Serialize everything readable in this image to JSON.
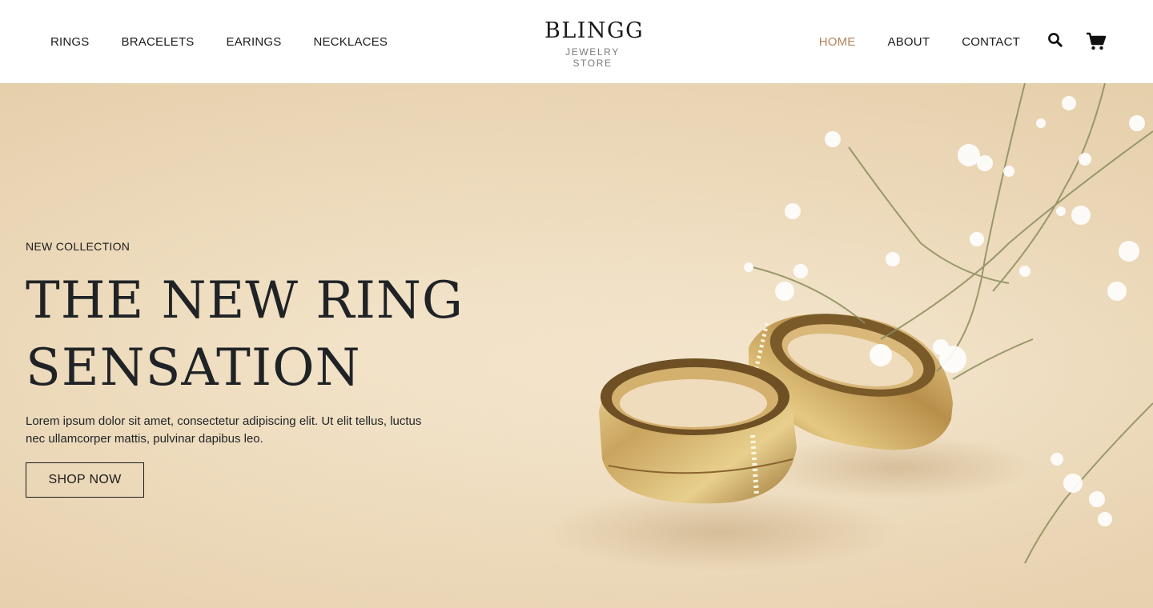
{
  "header": {
    "nav_left": [
      "RINGS",
      "BRACELETS",
      "EARINGS",
      "NECKLACES"
    ],
    "logo_title": "BLINGG",
    "logo_subtitle": "JEWELRY STORE",
    "nav_right": [
      "HOME",
      "ABOUT",
      "CONTACT"
    ],
    "active_item": "HOME",
    "icons": [
      "search-icon",
      "cart-icon"
    ]
  },
  "hero": {
    "eyebrow": "NEW COLLECTION",
    "headline_line1": "THE NEW RING",
    "headline_line2": "SENSATION",
    "description": "Lorem ipsum dolor sit amet, consectetur adipiscing elit. Ut elit tellus, luctus nec ullamcorper mattis, pulvinar dapibus leo.",
    "cta_label": "SHOP NOW",
    "image_subject": "two gold wedding rings with baby's breath flowers"
  },
  "colors": {
    "accent": "#b4835b",
    "text": "#1f2326",
    "hero_bg": "#efdcbc"
  }
}
